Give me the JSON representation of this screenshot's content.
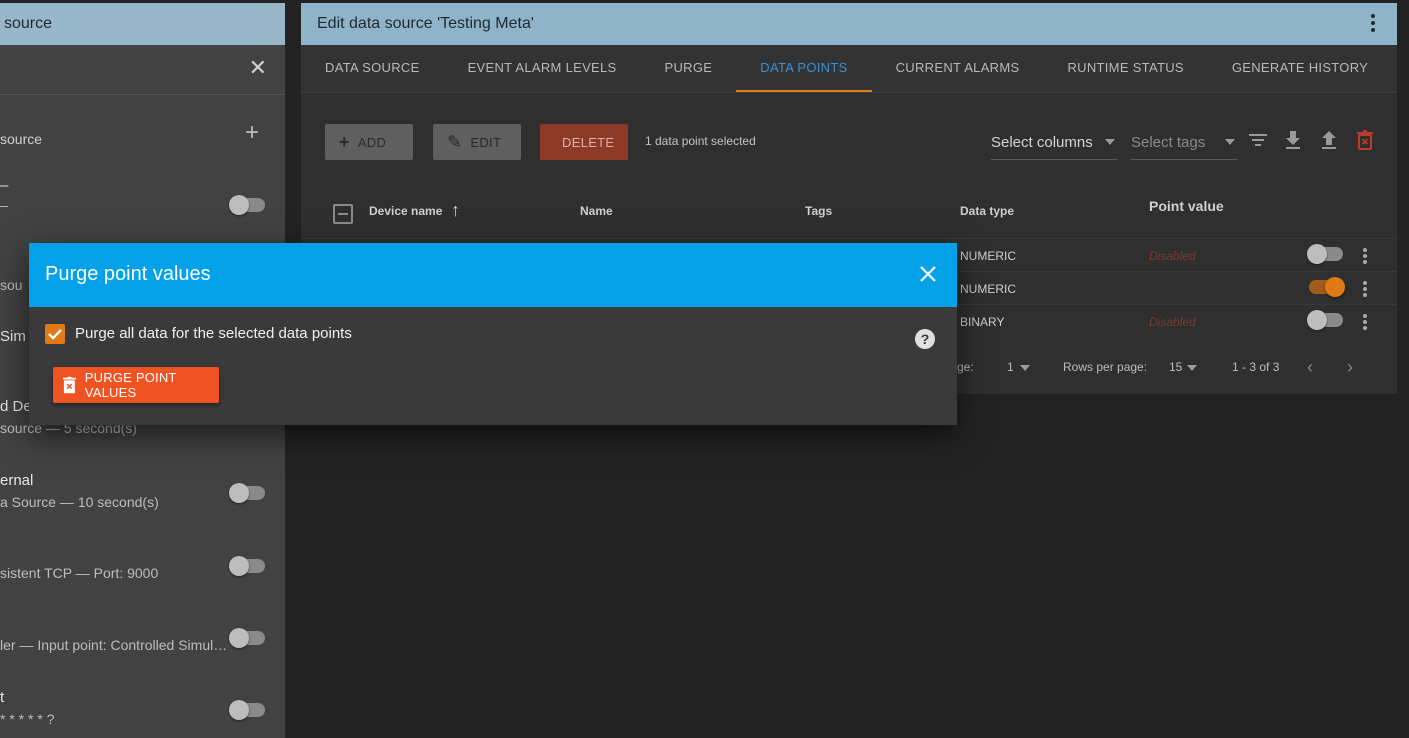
{
  "left_panel": {
    "header_title": "source",
    "add_row_label": "source",
    "items": [
      {
        "t1": "–",
        "t2": "–"
      },
      {
        "t1": "",
        "t2": "sou"
      },
      {
        "t1": "Sim",
        "t2": ""
      },
      {
        "t1": "d Dev",
        "t2": "source — 5 second(s)"
      },
      {
        "t1": "ernal",
        "t2": "a Source — 10 second(s)"
      },
      {
        "t1": "",
        "t2": "sistent TCP — Port: 9000"
      },
      {
        "t1": "",
        "t2": "ler — Input point: Controlled Simul…"
      },
      {
        "t1": "t",
        "t2": "* * * * * ?"
      }
    ]
  },
  "main": {
    "title": "Edit data source 'Testing Meta'",
    "tabs": [
      "DATA SOURCE",
      "EVENT ALARM LEVELS",
      "PURGE",
      "DATA POINTS",
      "CURRENT ALARMS",
      "RUNTIME STATUS",
      "GENERATE HISTORY"
    ],
    "active_tab": "DATA POINTS",
    "toolbar": {
      "add_label": "ADD",
      "edit_label": "EDIT",
      "delete_label": "DELETE",
      "selection_text": "1 data point selected",
      "select_columns": "Select columns",
      "select_tags": "Select tags"
    },
    "table": {
      "headers": {
        "device_name": "Device name",
        "name": "Name",
        "tags": "Tags",
        "data_type": "Data type",
        "point_value": "Point value"
      },
      "rows": [
        {
          "data_type": "NUMERIC",
          "point_value": "Disabled",
          "enabled": false
        },
        {
          "data_type": "NUMERIC",
          "point_value": "",
          "enabled": true
        },
        {
          "data_type": "BINARY",
          "point_value": "Disabled",
          "enabled": false
        }
      ]
    },
    "pager": {
      "page_label": "ge:",
      "page": "1",
      "rows_label": "Rows per page:",
      "rows_per_page": "15",
      "range": "1 - 3 of 3"
    }
  },
  "dialog": {
    "title": "Purge point values",
    "checkbox_label": "Purge all data for the selected data points",
    "checkbox_checked": true,
    "purge_button": "PURGE POINT VALUES"
  },
  "colors": {
    "accent": "#e07a17",
    "dialog_header": "#03a2e8",
    "purge_button": "#f05322",
    "active_tab": "#3c8fd0"
  }
}
